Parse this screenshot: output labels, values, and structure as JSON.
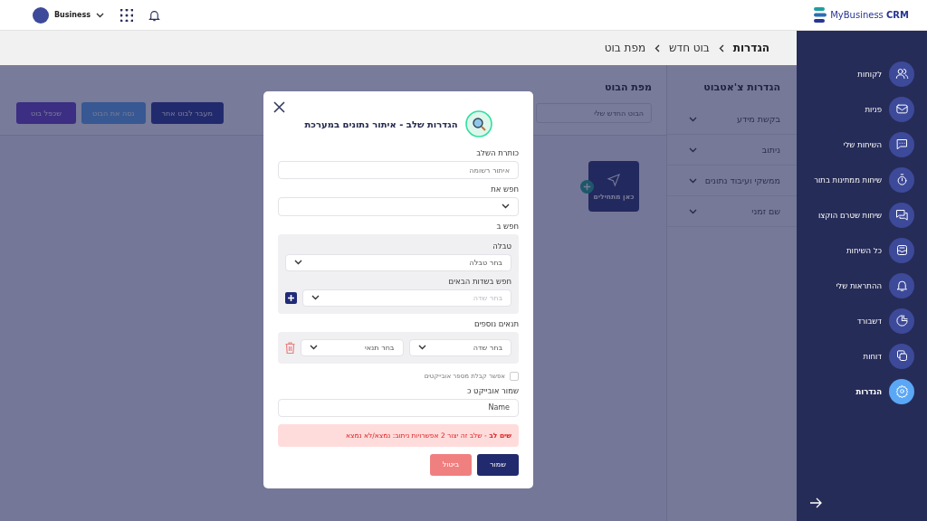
{
  "topbar": {
    "account": "Business",
    "logo": "MyBusiness **CRM**"
  },
  "breadcrumb": [
    "הגדרות",
    "בוט חדש",
    "מפת בוט"
  ],
  "sidebar": {
    "items": [
      {
        "label": "לקוחות",
        "kind": "people",
        "selected": false
      },
      {
        "label": "פניות",
        "kind": "mail",
        "selected": false
      },
      {
        "label": "השיחות שלי",
        "kind": "chat",
        "selected": false
      },
      {
        "label": "שיחות ממתינות בתור",
        "kind": "timer",
        "selected": false
      },
      {
        "label": "שיחות שטרם הוקצו",
        "kind": "chats",
        "selected": false
      },
      {
        "label": "כל השיחות",
        "kind": "inbox",
        "selected": false
      },
      {
        "label": "ההתראות שלי",
        "kind": "bell",
        "selected": false
      },
      {
        "label": "דשבורד",
        "kind": "pie",
        "selected": false
      },
      {
        "label": "דוחות",
        "kind": "copy",
        "selected": false
      },
      {
        "label": "הגדרות",
        "kind": "gear",
        "selected": true
      }
    ]
  },
  "bot_settings": {
    "title": "הגדרות צ'אטבוט",
    "sections": [
      {
        "label": "בקשת מידע",
        "expanded": false
      },
      {
        "label": "ניתוב",
        "expanded": false
      },
      {
        "label": "ממשקי ועיבוד נתונים",
        "expanded": false
      },
      {
        "label": "שם זמני",
        "expanded": false
      }
    ]
  },
  "bot_map": {
    "title": "מפת הבוט",
    "bot_name": "הבוט החדש שלי",
    "buttons": [
      {
        "label": "מעבר לבוט אחר",
        "kind": "navy"
      },
      {
        "label": "נסה את הבוט",
        "kind": "light"
      },
      {
        "label": "שכפל בוט",
        "kind": "purple"
      }
    ],
    "start_node": "כאן מתחילים"
  },
  "modal": {
    "title": "הגדרות שלב - איתור נתונים במערכת",
    "step_title": {
      "label": "כותרת השלב",
      "placeholder": "איתור רשומה"
    },
    "search_what": {
      "label": "חפש את"
    },
    "search_in": {
      "label": "חפש ב",
      "table_label": "טבלה",
      "table_placeholder": "בחר טבלה",
      "fields_label": "חפש בשדות הבאים",
      "fields_placeholder": "בחר שדה",
      "fields_disabled": true
    },
    "conditions": {
      "label": "תנאים נוספים",
      "field_placeholder": "בחר שדה",
      "condition_placeholder": "בחר תנאי"
    },
    "multiple": {
      "label": "אפשר קבלת מספר אובייקטים",
      "checked": false
    },
    "save_as": {
      "label": "שמור אובייקט כ",
      "value": "Name"
    },
    "alert": "**שים לב** - שלב זה יצור 2 אפשרויות ניתוב: נמצא/לא נמצא",
    "save": "שמור",
    "cancel": "ביטול"
  }
}
